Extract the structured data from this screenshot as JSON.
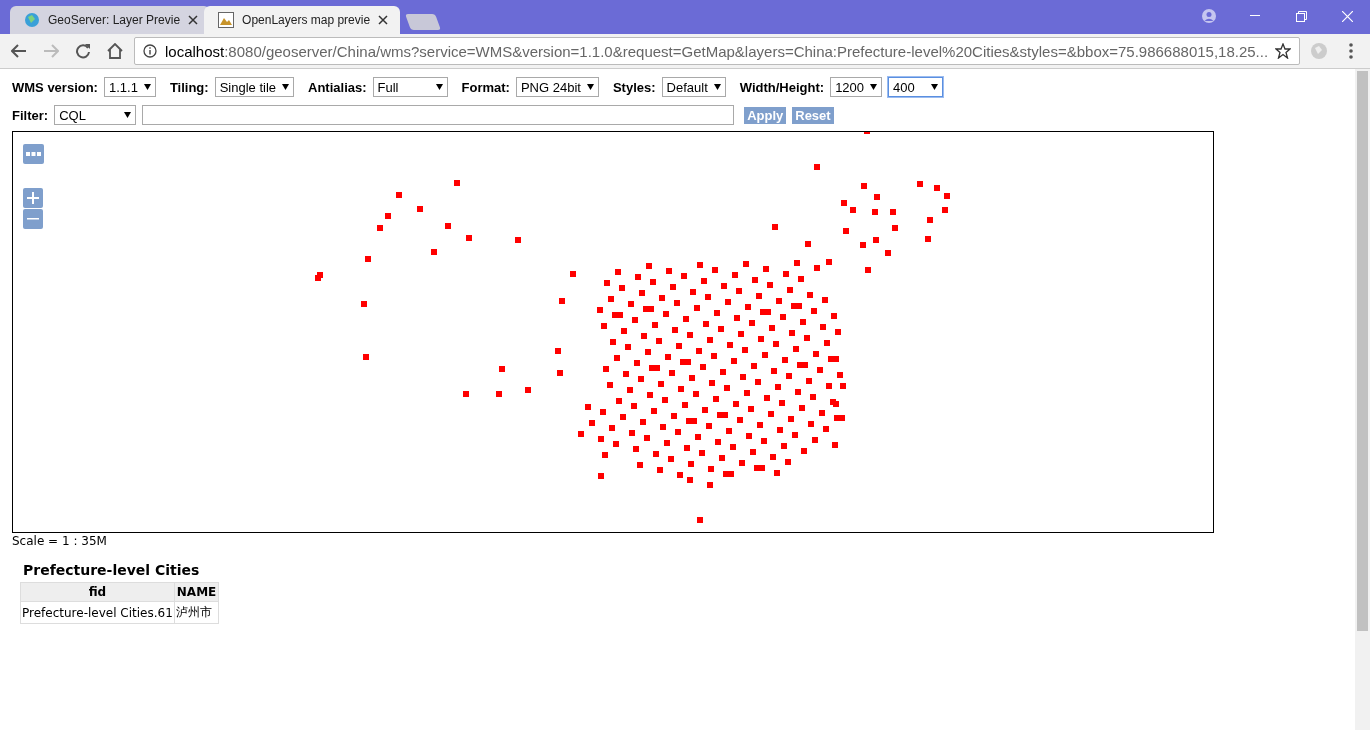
{
  "browser": {
    "tabs": [
      {
        "title": "GeoServer: Layer Previe",
        "selected": false
      },
      {
        "title": "OpenLayers map previe",
        "selected": true
      }
    ],
    "address": {
      "host": "localhost",
      "rest": ":8080/geoserver/China/wms?service=WMS&version=1.1.0&request=GetMap&layers=China:Prefecture-level%20Cities&styles=&bbox=75.986688015,18.25..."
    }
  },
  "options": [
    {
      "label": "WMS version:",
      "selects": [
        {
          "value": "1.1.1",
          "focused": false
        }
      ]
    },
    {
      "label": "Tiling:",
      "selects": [
        {
          "value": "Single tile",
          "focused": false
        }
      ]
    },
    {
      "label": "Antialias:",
      "selects": [
        {
          "value": "Full",
          "focused": false
        }
      ]
    },
    {
      "label": "Format:",
      "selects": [
        {
          "value": "PNG 24bit",
          "focused": false
        }
      ]
    },
    {
      "label": "Styles:",
      "selects": [
        {
          "value": "Default",
          "focused": false
        }
      ]
    },
    {
      "label": "Width/Height:",
      "selects": [
        {
          "value": "1200",
          "focused": false
        },
        {
          "value": "400",
          "focused": true
        }
      ]
    }
  ],
  "filter": {
    "label": "Filter:",
    "select": "CQL",
    "buttons": [
      "Apply",
      "Reset"
    ]
  },
  "map": {
    "scale": "Scale = 1 : 35M"
  },
  "results": {
    "title": "Prefecture-level Cities",
    "columns": [
      "fid",
      "NAME"
    ],
    "rows": [
      [
        "Prefecture-level Cities.61",
        "泸州市"
      ]
    ]
  }
}
